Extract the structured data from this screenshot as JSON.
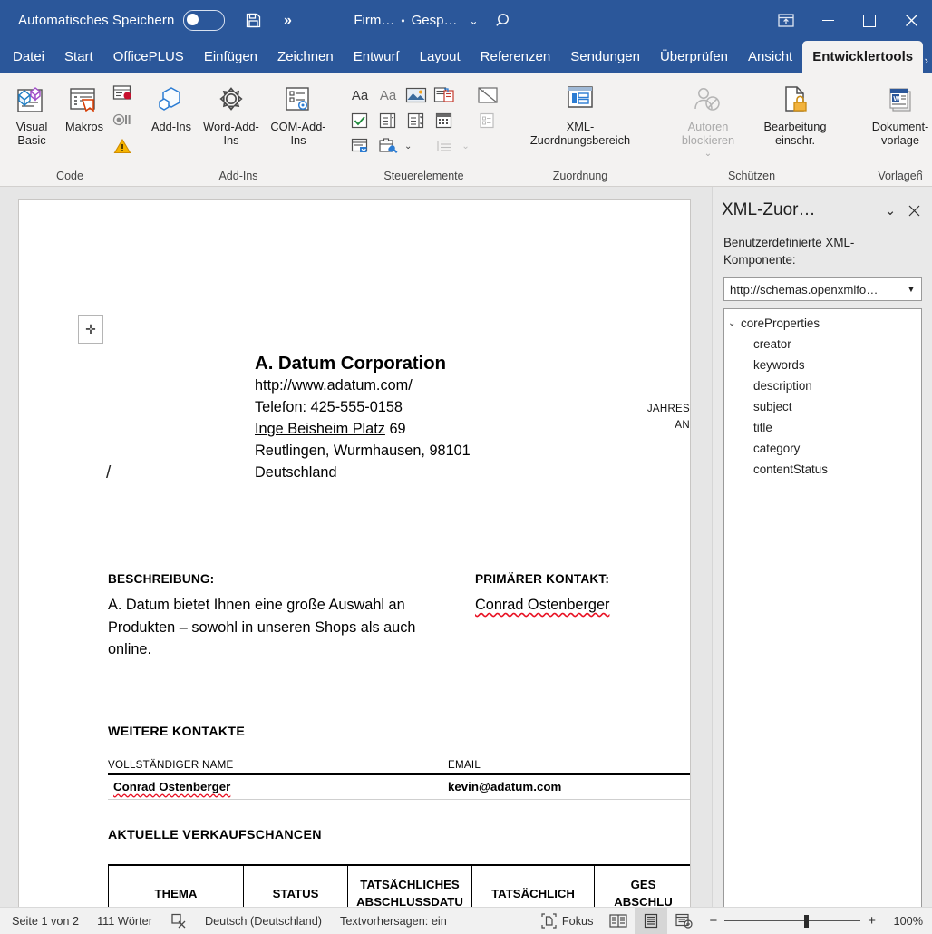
{
  "titlebar": {
    "autosave_label": "Automatisches Speichern",
    "autosave_state": "off",
    "save_icon": "save-disk-icon",
    "more_icon": "more-chevrons-icon",
    "doc_name": "Firm…",
    "doc_separator": "•",
    "doc_status": "Gesp…",
    "doc_chevron": "chevron-down-icon",
    "search_icon": "search-icon",
    "ribbon_display_icon": "ribbon-display-options-icon",
    "minimize_icon": "minimize-icon",
    "maximize_icon": "maximize-icon",
    "close_icon": "close-icon",
    "accent_color": "#2b579a"
  },
  "tabs": [
    {
      "label": "Datei",
      "active": false
    },
    {
      "label": "Start",
      "active": false
    },
    {
      "label": "OfficePLUS",
      "active": false
    },
    {
      "label": "Einfügen",
      "active": false
    },
    {
      "label": "Zeichnen",
      "active": false
    },
    {
      "label": "Entwurf",
      "active": false
    },
    {
      "label": "Layout",
      "active": false
    },
    {
      "label": "Referenzen",
      "active": false
    },
    {
      "label": "Sendungen",
      "active": false
    },
    {
      "label": "Überprüfen",
      "active": false
    },
    {
      "label": "Ansicht",
      "active": false
    },
    {
      "label": "Entwicklertools",
      "active": true
    }
  ],
  "tab_overflow": "›",
  "ribbon": {
    "groups": [
      {
        "name": "Code",
        "label": "Code",
        "buttons": [
          {
            "label": "Visual Basic",
            "icon": "visual-basic-icon",
            "disabled": false
          },
          {
            "label": "Makros",
            "icon": "macros-icon",
            "disabled": false
          }
        ],
        "small_buttons": [
          {
            "label": "Makro aufzeichnen",
            "icon": "record-macro-icon"
          },
          {
            "label": "Aufzeichnung anhalten",
            "icon": "pause-recording-icon"
          },
          {
            "label": "Makrosicherheit",
            "icon": "macro-security-warning-icon"
          }
        ]
      },
      {
        "name": "Add-Ins",
        "label": "Add-Ins",
        "buttons": [
          {
            "label": "Add-Ins",
            "icon": "addins-icon",
            "disabled": false
          },
          {
            "label": "Word-Add-Ins",
            "icon": "word-addins-gear-icon",
            "disabled": false
          },
          {
            "label": "COM-Add-Ins",
            "icon": "com-addins-icon",
            "disabled": false
          }
        ]
      },
      {
        "name": "Steuerelemente",
        "label": "Steuerelemente",
        "small_buttons": [
          {
            "label": "Rich-Text-Inhaltssteuerelement",
            "icon": "rich-text-aa-icon"
          },
          {
            "label": "Nur-Text-Inhaltssteuerelement",
            "icon": "plain-text-aa-icon"
          },
          {
            "label": "Bildinhaltssteuerelement",
            "icon": "picture-control-icon"
          },
          {
            "label": "Bausteinkatalog",
            "icon": "building-block-gallery-icon"
          },
          {
            "label": "Kontrollkästchen",
            "icon": "checkbox-control-icon"
          },
          {
            "label": "Kombinationsfeld",
            "icon": "combo-box-control-icon"
          },
          {
            "label": "Dropdownliste",
            "icon": "dropdown-list-control-icon"
          },
          {
            "label": "Datumsauswahl",
            "icon": "date-picker-control-icon"
          },
          {
            "label": "Wiederholender Abschnitt",
            "icon": "repeating-section-icon"
          },
          {
            "label": "Vorversionstools",
            "icon": "legacy-tools-icon"
          },
          {
            "label": "Entwurfsmodus",
            "icon": "design-mode-icon"
          },
          {
            "label": "Eigenschaften",
            "icon": "properties-icon"
          },
          {
            "label": "Gruppieren",
            "icon": "group-icon"
          }
        ]
      },
      {
        "name": "Zuordnung",
        "label": "Zuordnung",
        "buttons": [
          {
            "label": "XML-Zuordnungsbereich",
            "icon": "xml-mapping-pane-icon",
            "disabled": false
          }
        ]
      },
      {
        "name": "Schützen",
        "label": "Schützen",
        "buttons": [
          {
            "label": "Autoren blockieren",
            "icon": "block-authors-icon",
            "disabled": true
          },
          {
            "label": "Bearbeitung einschr.",
            "icon": "restrict-editing-lock-icon",
            "disabled": false
          }
        ]
      },
      {
        "name": "Vorlagen",
        "label": "Vorlagen",
        "buttons": [
          {
            "label": "Dokument- vorlage",
            "icon": "document-template-word-icon",
            "disabled": false
          }
        ]
      }
    ],
    "collapse_icon": "collapse-ribbon-chevron-icon"
  },
  "document": {
    "anchor_icon": "move-anchor-icon",
    "stray_slash": "/",
    "company": {
      "name": "A. Datum Corporation",
      "website": "http://www.adatum.com/",
      "phone": "Telefon: 425-555-0158",
      "street_underlined": "Inge Beisheim Platz",
      "street_number": "69",
      "city_line": "Reutlingen, Wurmhausen, 98101",
      "country": "Deutschland"
    },
    "yearly_label_line1": "JAHRES",
    "yearly_label_line2": "AN",
    "description": {
      "heading": "BESCHREIBUNG:",
      "text": "A. Datum bietet Ihnen eine große Auswahl an Produkten – sowohl in unseren Shops als auch online."
    },
    "primary_contact": {
      "heading": "PRIMÄRER KONTAKT:",
      "name": "Conrad Ostenberger"
    },
    "more_contacts": {
      "title": "WEITERE KONTAKTE",
      "columns": [
        "VOLLSTÄNDIGER NAME",
        "EMAIL"
      ],
      "rows": [
        {
          "name": "Conrad Ostenberger",
          "email": "kevin@adatum.com"
        }
      ]
    },
    "opportunities": {
      "title": "AKTUELLE VERKAUFSCHANCEN",
      "columns": [
        "THEMA",
        "STATUS",
        "TATSÄCHLICHES ABSCHLUSSDATU",
        "TATSÄCHLICH",
        "GES ABSCHLU"
      ]
    }
  },
  "xml_pane": {
    "title": "XML-Zuor…",
    "collapse_icon": "chevron-down-icon",
    "close_icon": "close-icon",
    "label": "Benutzerdefinierte XML-Komponente:",
    "combo_value": "http://schemas.openxmlfo…",
    "combo_arrow_icon": "dropdown-arrow-icon",
    "tree": {
      "root": {
        "label": "coreProperties",
        "expanded": true,
        "twisty_icon": "chevron-down-icon"
      },
      "children": [
        "creator",
        "keywords",
        "description",
        "subject",
        "title",
        "category",
        "contentStatus"
      ]
    }
  },
  "statusbar": {
    "page_info": "Seite 1 von 2",
    "word_count": "111 Wörter",
    "proofing_icon": "proofing-errors-icon",
    "language": "Deutsch (Deutschland)",
    "text_predictions": "Textvorhersagen: ein",
    "focus_label": "Fokus",
    "focus_icon": "focus-mode-icon",
    "view_read_icon": "read-mode-icon",
    "view_print_icon": "print-layout-icon",
    "view_web_icon": "web-layout-icon",
    "zoom_out_icon": "zoom-minus-icon",
    "zoom_in_icon": "zoom-plus-icon",
    "zoom_value": "100%"
  }
}
